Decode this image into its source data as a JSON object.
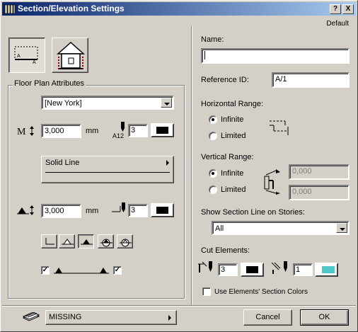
{
  "window": {
    "title": "Section/Elevation Settings",
    "help_btn": "?",
    "close_btn": "X",
    "default_label": "Default"
  },
  "left": {
    "group_title": "Floor Plan Attributes",
    "line_type_value": "[New York]",
    "marker_size_value": "3,000",
    "marker_size_unit": "mm",
    "marker_pen_label": "A12",
    "marker_pen_value": "3",
    "line_style_label": "Solid Line",
    "line_height_value": "3,000",
    "line_height_unit": "mm",
    "line_pen_value": "3"
  },
  "right": {
    "name_label": "Name:",
    "name_value": "",
    "ref_label": "Reference ID:",
    "ref_value": "A/1",
    "hrange_label": "Horizontal Range:",
    "hrange_infinite": "Infinite",
    "hrange_limited": "Limited",
    "vrange_label": "Vertical Range:",
    "vrange_infinite": "Infinite",
    "vrange_limited": "Limited",
    "vrange_top_value": "0,000",
    "vrange_bottom_value": "0,000",
    "stories_label": "Show Section Line on Stories:",
    "stories_value": "All",
    "cut_label": "Cut Elements:",
    "cut_pen1_value": "3",
    "cut_pen2_value": "1",
    "use_colors_label": "Use Elements' Section Colors"
  },
  "bottom": {
    "layer_value": "MISSING",
    "cancel_label": "Cancel",
    "ok_label": "OK"
  },
  "colors": {
    "title_start": "#0a246a",
    "title_end": "#a6caf0",
    "fill_teal": "#4fc7c7",
    "face": "#d4d0c8"
  }
}
